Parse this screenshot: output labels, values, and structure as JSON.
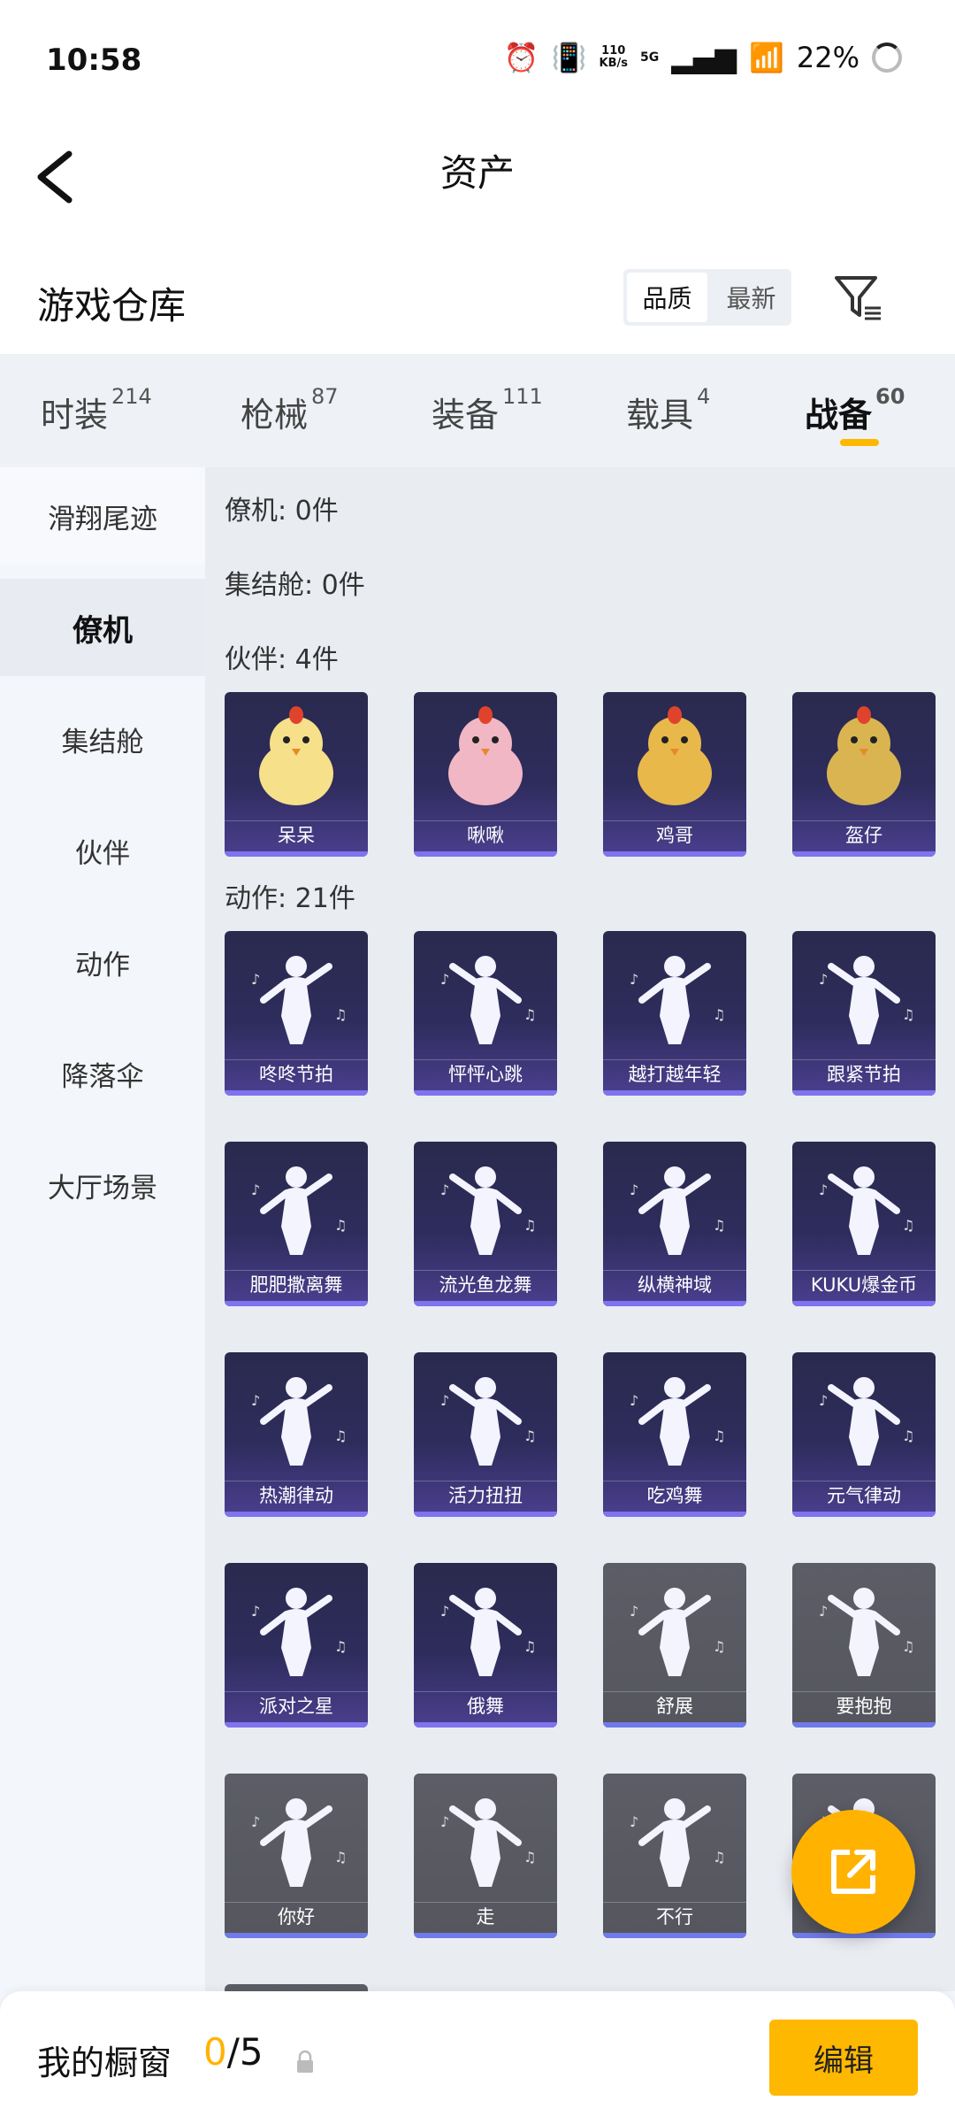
{
  "status_bar": {
    "time": "10:58",
    "net_speed_top": "110",
    "net_speed_bottom": "KB/s",
    "net_type": "5G",
    "battery": "22%"
  },
  "header": {
    "title": "资产"
  },
  "section": {
    "title": "游戏仓库",
    "sort_options": [
      "品质",
      "最新"
    ]
  },
  "tabs": [
    {
      "label": "时装",
      "count": "214"
    },
    {
      "label": "枪械",
      "count": "87"
    },
    {
      "label": "装备",
      "count": "111"
    },
    {
      "label": "载具",
      "count": "4"
    },
    {
      "label": "战备",
      "count": "60"
    }
  ],
  "sidebar": [
    "滑翔尾迹",
    "僚机",
    "集结舱",
    "伙伴",
    "动作",
    "降落伞",
    "大厅场景"
  ],
  "groups": {
    "wingman": "僚机: 0件",
    "capsule": "集结舱: 0件",
    "partner": "伙伴: 4件",
    "emote": "动作: 21件"
  },
  "partners": [
    "呆呆",
    "啾啾",
    "鸡哥",
    "盔仔"
  ],
  "emotes": [
    "咚咚节拍",
    "怦怦心跳",
    "越打越年轻",
    "跟紧节拍",
    "肥肥撒离舞",
    "流光鱼龙舞",
    "纵横神域",
    "KUKU爆金币",
    "热潮律动",
    "活力扭扭",
    "吃鸡舞",
    "元气律动",
    "派对之星",
    "俄舞",
    "舒展",
    "要抱抱",
    "你好",
    "走",
    "不行",
    ""
  ],
  "bottom": {
    "label": "我的橱窗",
    "count_current": "0",
    "count_total": "/5",
    "edit": "编辑"
  },
  "colors": {
    "accent": "#ffb800",
    "card_purple": "#2e2c5c",
    "card_grey": "#5c5d66"
  }
}
